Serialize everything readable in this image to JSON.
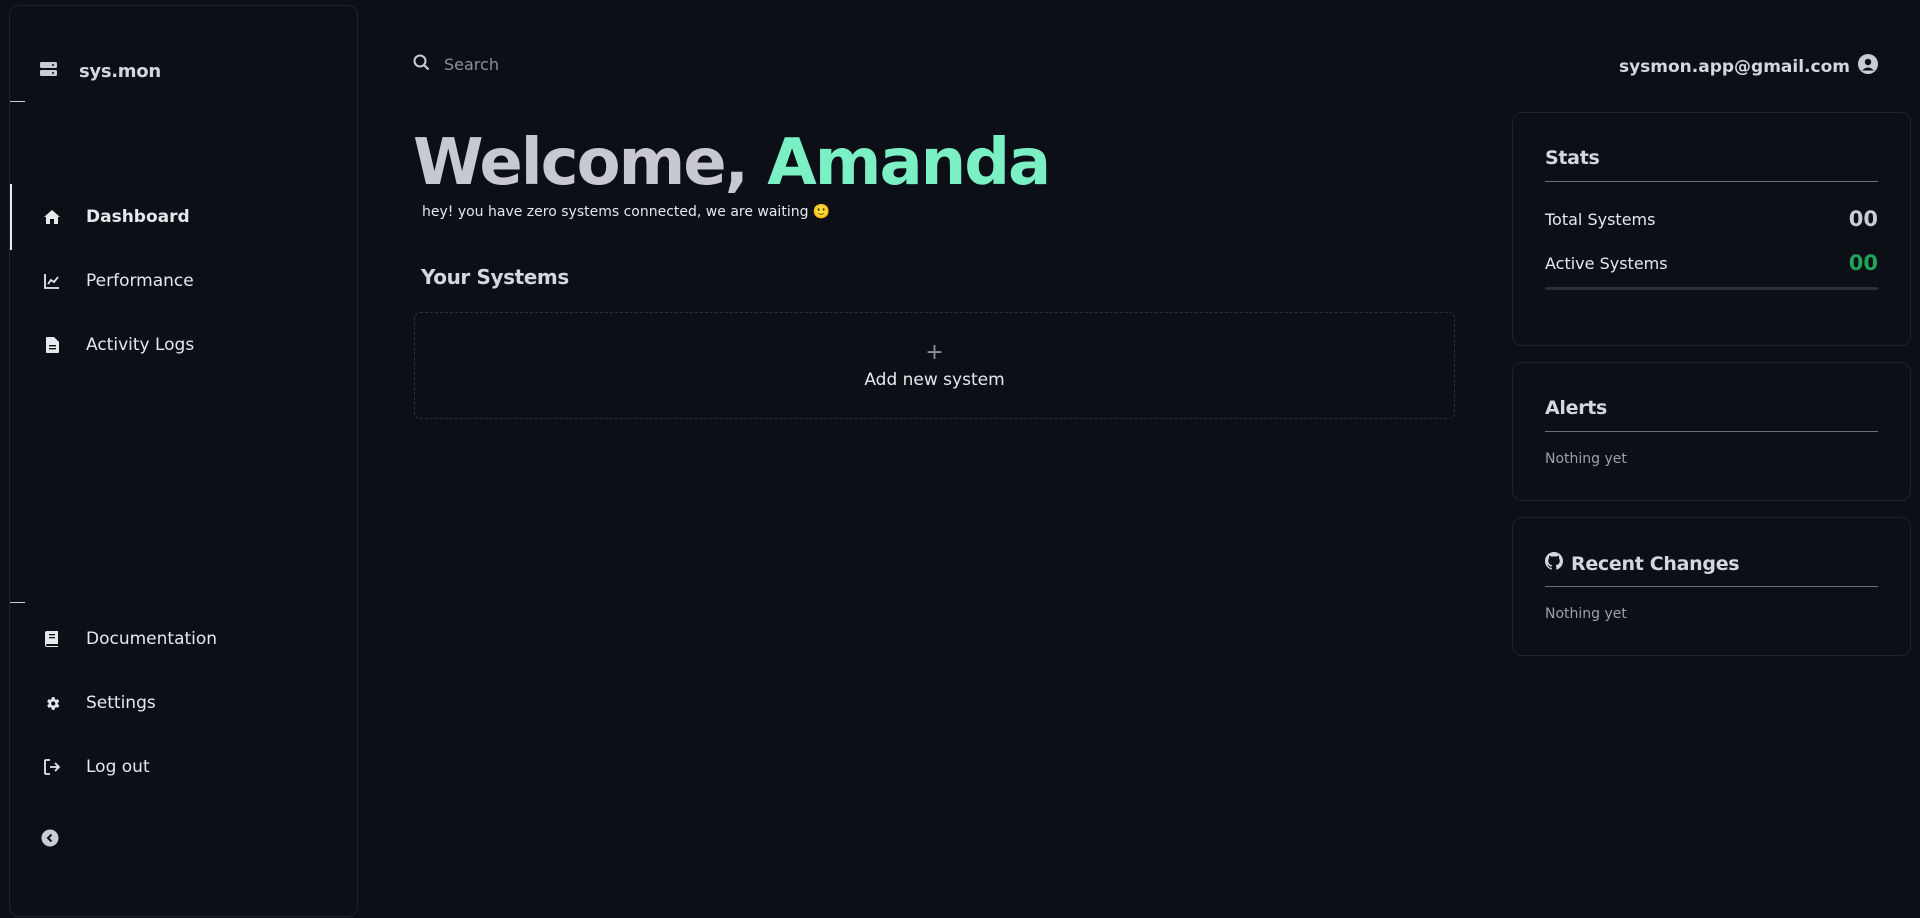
{
  "sidebar": {
    "brand": "sys.mon",
    "nav_top": [
      {
        "label": "Dashboard",
        "icon": "home-icon"
      },
      {
        "label": "Performance",
        "icon": "chart-line-icon"
      },
      {
        "label": "Activity Logs",
        "icon": "file-icon"
      }
    ],
    "nav_bottom": [
      {
        "label": "Documentation",
        "icon": "book-icon"
      },
      {
        "label": "Settings",
        "icon": "gear-icon"
      },
      {
        "label": "Log out",
        "icon": "logout-icon"
      }
    ]
  },
  "header": {
    "search_placeholder": "Search",
    "user_email": "sysmon.app@gmail.com"
  },
  "main": {
    "welcome_prefix": "Welcome, ",
    "welcome_name": "Amanda",
    "subline": "hey! you have zero systems connected, we are waiting 🙂",
    "section_title": "Your Systems",
    "add_label": "Add new system",
    "add_plus": "+"
  },
  "stats": {
    "title": "Stats",
    "total_label": "Total Systems",
    "total_value": "00",
    "active_label": "Active Systems",
    "active_value": "00",
    "active_fraction": 0
  },
  "alerts": {
    "title": "Alerts",
    "empty": "Nothing yet"
  },
  "changes": {
    "title": "Recent Changes",
    "empty": "Nothing yet"
  },
  "colors": {
    "background": "#0c0f16",
    "accent": "#7cf0c5",
    "success": "#22a35a"
  }
}
